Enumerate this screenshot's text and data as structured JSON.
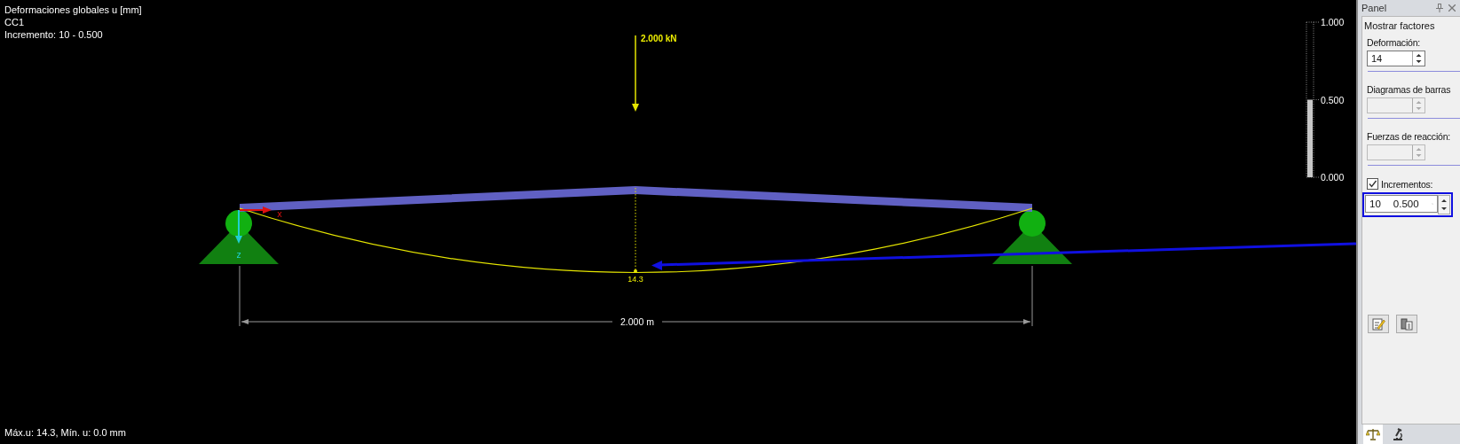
{
  "viewport": {
    "title": "Deformaciones globales u [mm]",
    "load_case": "CC1",
    "increment": "Incremento: 10 - 0.500",
    "summary": "Máx.u: 14.3, Mín. u: 0.0 mm",
    "load_label": "2.000 kN",
    "max_label": "14.3",
    "dimension": "2.000 m",
    "axis_x": "x",
    "axis_z": "z",
    "scale": {
      "level": 0.5,
      "ticks": [
        "1.000",
        "0.500",
        "0.000"
      ]
    }
  },
  "panel": {
    "title": "Panel",
    "heading": "Mostrar factores",
    "sections": [
      {
        "label": "Deformación:",
        "value": "14",
        "disabled": false
      },
      {
        "label": "Diagramas de barras",
        "disabled": true
      },
      {
        "label": "Fuerzas de reacción:",
        "disabled": true
      }
    ],
    "increments": {
      "label": "Incrementos:",
      "checked": true,
      "value_1": "10",
      "value_2": "0.500"
    },
    "tabs": [
      {
        "selected": true
      },
      {
        "selected": false
      }
    ]
  }
}
